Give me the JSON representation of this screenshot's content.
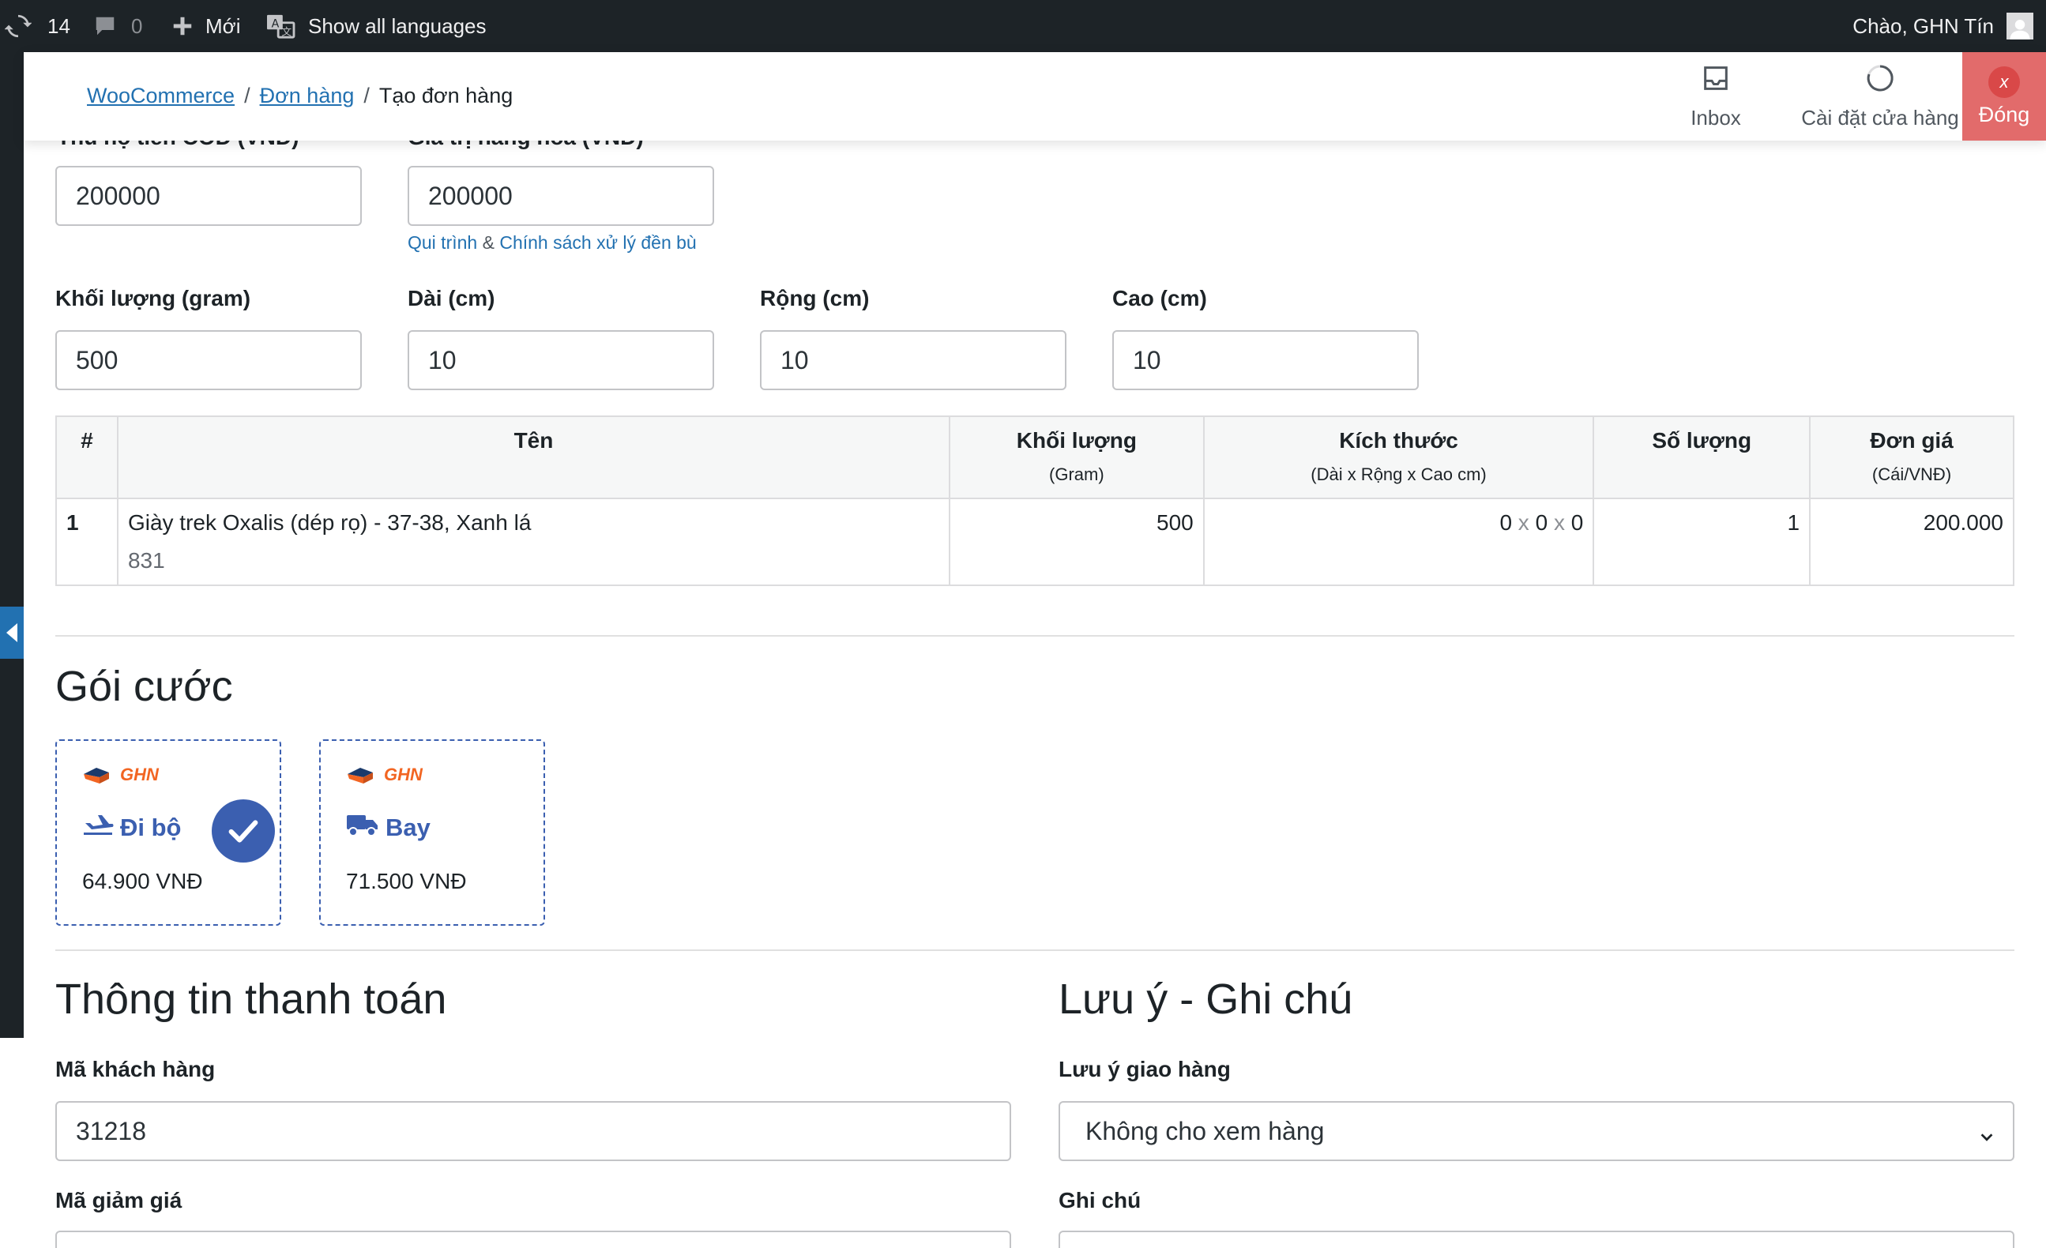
{
  "adminbar": {
    "updates_count": "14",
    "comments_count": "0",
    "new_label": "Mới",
    "languages_label": "Show all languages",
    "greeting": "Chào, GHN Tín"
  },
  "header": {
    "breadcrumbs": [
      "WooCommerce",
      "Đơn hàng",
      "Tạo đơn hàng"
    ],
    "inbox_label": "Inbox",
    "store_setup_label": "Cài đặt cửa hàng",
    "close_label": "Đóng",
    "close_x": "x"
  },
  "form": {
    "cod_label": "Thu hộ tiền COD (VNĐ)",
    "cod_value": "200000",
    "goods_value_label": "Giá trị hàng hoá (VNĐ)",
    "goods_value": "200000",
    "policy_link_1": "Qui trình",
    "policy_amp": "&",
    "policy_link_2": "Chính sách xử lý đền bù",
    "weight_label": "Khối lượng (gram)",
    "weight_value": "500",
    "length_label": "Dài (cm)",
    "length_value": "10",
    "width_label": "Rộng (cm)",
    "width_value": "10",
    "height_label": "Cao (cm)",
    "height_value": "10"
  },
  "table": {
    "headers": {
      "index": "#",
      "name": "Tên",
      "weight": "Khối lượng",
      "weight_sub": "(Gram)",
      "size": "Kích thước",
      "size_sub": "(Dài x Rộng x Cao cm)",
      "qty": "Số lượng",
      "price": "Đơn giá",
      "price_sub": "(Cái/VNĐ)"
    },
    "rows": [
      {
        "index": "1",
        "name": "Giày trek Oxalis (dép rọ) - 37-38, Xanh lá",
        "sku": "831",
        "weight": "500",
        "dim_l": "0",
        "dim_w": "0",
        "dim_h": "0",
        "dim_sep": "x",
        "qty": "1",
        "price": "200.000"
      }
    ]
  },
  "rates": {
    "title": "Gói cước",
    "brand": "GHN",
    "items": [
      {
        "name": "Đi bộ",
        "price": "64.900 VNĐ",
        "icon": "plane-icon",
        "selected": true
      },
      {
        "name": "Bay",
        "price": "71.500 VNĐ",
        "icon": "truck-icon",
        "selected": false
      }
    ]
  },
  "payment": {
    "title": "Thông tin thanh toán",
    "customer_code_label": "Mã khách hàng",
    "customer_code_value": "31218",
    "discount_label": "Mã giảm giá"
  },
  "notes": {
    "title": "Lưu ý - Ghi chú",
    "delivery_note_label": "Lưu ý giao hàng",
    "delivery_note_value": "Không cho xem hàng",
    "note_label": "Ghi chú"
  },
  "colors": {
    "adminbar_bg": "#1d2327",
    "link": "#2271b1",
    "close_button": "#e26b6b",
    "rate_accent": "#3b5fb0",
    "ghn_orange": "#f26522"
  }
}
